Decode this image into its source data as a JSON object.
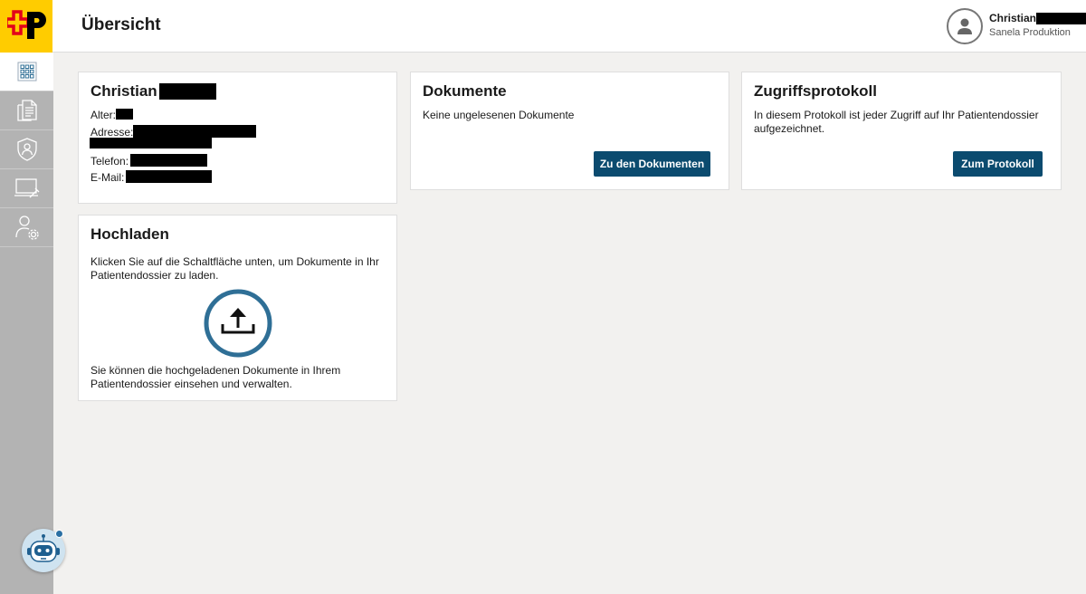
{
  "header": {
    "title": "Übersicht",
    "user_name": "Christian",
    "user_subtitle": "Sanela Produktion"
  },
  "sidebar": {
    "items": [
      {
        "icon": "grid-icon",
        "active": true
      },
      {
        "icon": "documents-icon"
      },
      {
        "icon": "shield-user-icon"
      },
      {
        "icon": "monitor-tools-icon"
      },
      {
        "icon": "user-settings-icon"
      }
    ]
  },
  "patient_card": {
    "name": "Christian",
    "age_label": "Alter:",
    "address_label": "Adresse:",
    "phone_label": "Telefon:",
    "email_label": "E-Mail:"
  },
  "documents_card": {
    "title": "Dokumente",
    "text": "Keine ungelesenen Dokumente",
    "button": "Zu den Dokumenten"
  },
  "protocol_card": {
    "title": "Zugriffsprotokoll",
    "text": "In diesem Protokoll ist jeder Zugriff auf Ihr Patientendossier aufgezeichnet.",
    "button": "Zum Protokoll"
  },
  "upload_card": {
    "title": "Hochladen",
    "text_top": "Klicken Sie auf die Schaltfläche unten, um Dokumente in Ihr Patientendossier zu laden.",
    "text_bottom": "Sie können die hochgeladenen Dokumente in Ihrem Patientendossier einsehen und verwalten."
  },
  "colors": {
    "brand_yellow": "#ffcc00",
    "button_blue": "#0b4b6f",
    "upload_ring": "#2f6f96"
  }
}
